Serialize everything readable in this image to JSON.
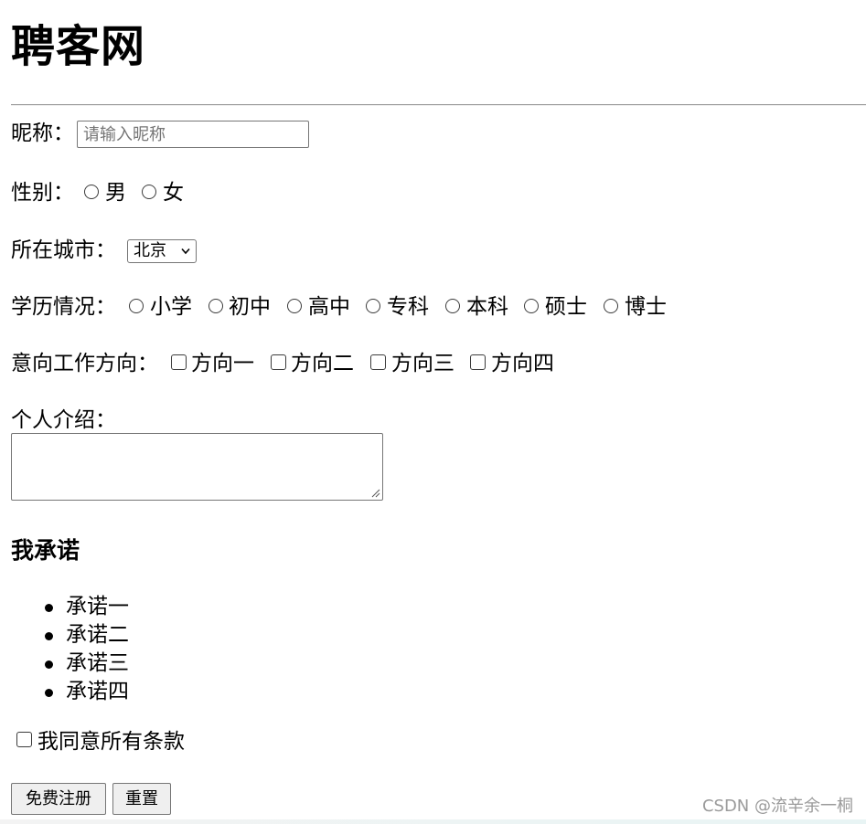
{
  "page": {
    "title": "聘客网"
  },
  "form": {
    "nickname": {
      "label": "昵称：",
      "placeholder": "请输入昵称",
      "value": ""
    },
    "gender": {
      "label": "性别：",
      "options": [
        "男",
        "女"
      ]
    },
    "city": {
      "label": "所在城市：",
      "selected": "北京"
    },
    "education": {
      "label": "学历情况：",
      "options": [
        "小学",
        "初中",
        "高中",
        "专科",
        "本科",
        "硕士",
        "博士"
      ]
    },
    "direction": {
      "label": "意向工作方向：",
      "options": [
        "方向一",
        "方向二",
        "方向三",
        "方向四"
      ]
    },
    "intro": {
      "label": "个人介绍：",
      "value": ""
    },
    "promise": {
      "heading": "我承诺",
      "items": [
        "承诺一",
        "承诺二",
        "承诺三",
        "承诺四"
      ]
    },
    "agree": {
      "label": "我同意所有条款"
    },
    "buttons": {
      "register": "免费注册",
      "reset": "重置"
    }
  },
  "watermark": "CSDN @流辛余一桐",
  "colors": {
    "border": "#767676",
    "button_bg": "#efefef",
    "watermark": "#9a9a9a"
  }
}
